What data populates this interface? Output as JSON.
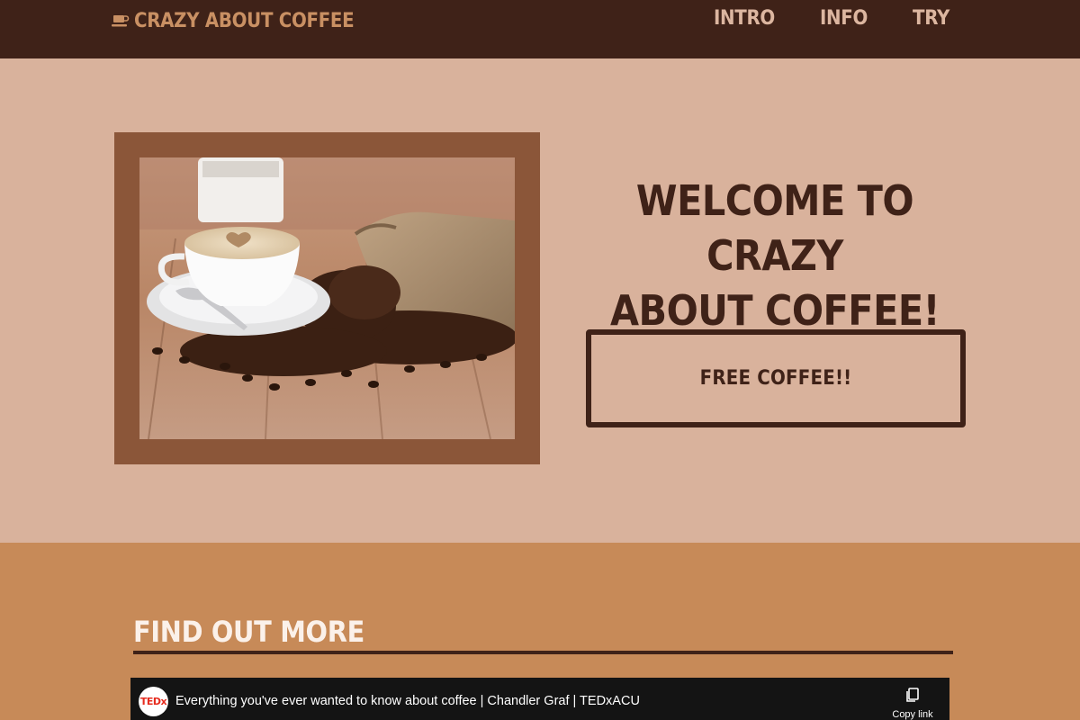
{
  "header": {
    "brand_label": "CRAZY ABOUT COFFEE",
    "brand_icon": "coffee-cup-icon",
    "nav": [
      {
        "label": "INTRO"
      },
      {
        "label": "INFO"
      },
      {
        "label": "TRY"
      }
    ]
  },
  "hero": {
    "welcome_line1": "WELCOME TO CRAZY",
    "welcome_line2": "ABOUT COFFEE!",
    "cta_label": "FREE COFFEE!!"
  },
  "more": {
    "title": "FIND OUT MORE"
  },
  "video": {
    "channel_logo_text": "TEDx",
    "title": "Everything you've ever wanted to know about coffee | Chandler Graf | TEDxACU",
    "copy_label": "Copy link",
    "copy_icon": "copy-icon"
  },
  "colors": {
    "header_bg": "#3f2218",
    "brand": "#c99063",
    "nav": "#dcb6a0",
    "hero_bg": "#d9b29c",
    "frame": "#8b5639",
    "section_bg": "#c78a58",
    "dark_text": "#3f2218"
  }
}
